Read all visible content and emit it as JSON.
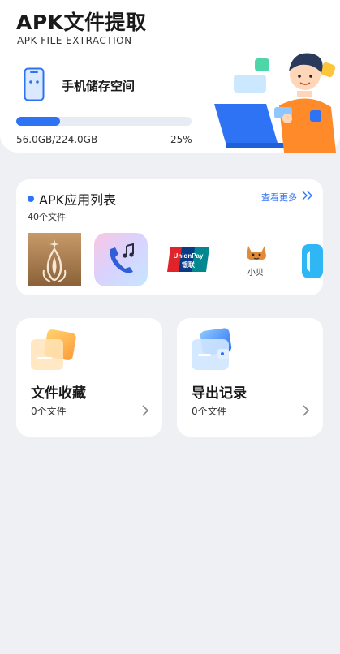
{
  "header": {
    "title": "APK文件提取",
    "subtitle": "APK FILE EXTRACTION",
    "storage_label": "手机储存空间",
    "storage_usage": "56.0GB/224.0GB",
    "storage_percent_text": "25%",
    "storage_fraction": 0.25
  },
  "apk_list": {
    "title": "APK应用列表",
    "count": "40个文件",
    "view_more": "查看更多",
    "apps": [
      {
        "name": "app-gold-flame",
        "label": ""
      },
      {
        "name": "app-music-call",
        "label": ""
      },
      {
        "name": "app-unionpay",
        "label": ""
      },
      {
        "name": "app-xiaobei",
        "label": "小贝"
      },
      {
        "name": "app-partial-blue",
        "label": ""
      }
    ]
  },
  "favorites": {
    "title": "文件收藏",
    "count": "0个文件"
  },
  "exports": {
    "title": "导出记录",
    "count": "0个文件"
  },
  "colors": {
    "accent": "#2f73f5",
    "background": "#eff0f4",
    "card": "#ffffff"
  }
}
